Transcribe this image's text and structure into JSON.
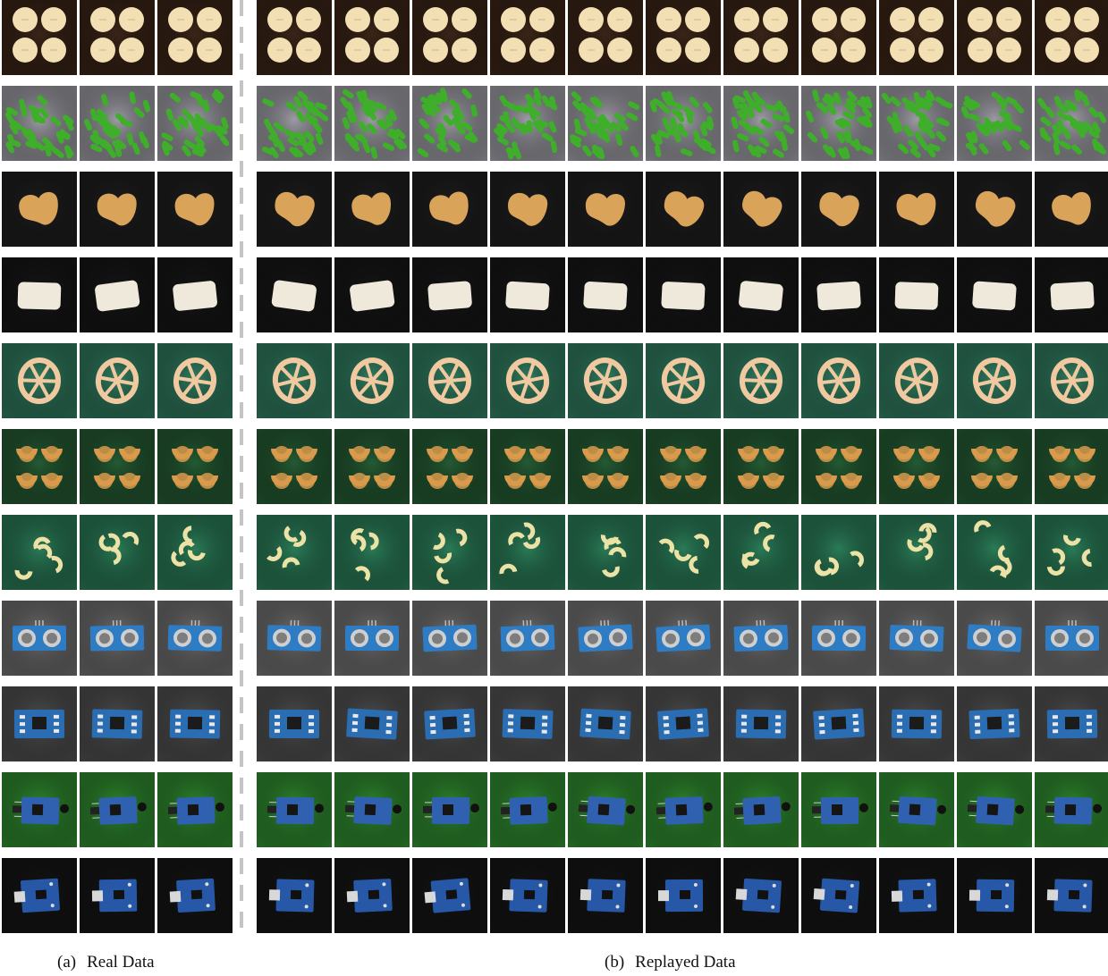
{
  "captions": {
    "real": {
      "tag": "(a)",
      "text": "Real Data"
    },
    "replayed": {
      "tag": "(b)",
      "text": "Replayed Data"
    }
  },
  "panels": {
    "real_columns": 3,
    "replayed_columns": 11
  },
  "rows": [
    {
      "object": "round-tablets",
      "background": "#3a2417",
      "object_color": "#f2dfb4"
    },
    {
      "object": "green-capsules",
      "background": "#9c9ba3",
      "object_color": "#3fae2a"
    },
    {
      "object": "cashew",
      "background": "#1e1e1e",
      "object_color": "#d9a35a"
    },
    {
      "object": "chewing-gum",
      "background": "#161616",
      "object_color": "#efe9dc"
    },
    {
      "object": "wheel-pasta",
      "background": "#2f7a5e",
      "object_color": "#f0c9a0"
    },
    {
      "object": "four-snacks",
      "background": "#245a33",
      "object_color": "#d99a4c"
    },
    {
      "object": "macaroni",
      "background": "#2a7b57",
      "object_color": "#ece2a6"
    },
    {
      "object": "ultrasonic-sensor-board",
      "background": "#6f6f6f",
      "object_color": "#2d7cc4"
    },
    {
      "object": "circuit-board",
      "background": "#505050",
      "object_color": "#2b6db3"
    },
    {
      "object": "ir-sensor-board",
      "background": "#2f8a2f",
      "object_color": "#2f61b0"
    },
    {
      "object": "usb-charger-board",
      "background": "#151515",
      "object_color": "#2758a8"
    }
  ]
}
